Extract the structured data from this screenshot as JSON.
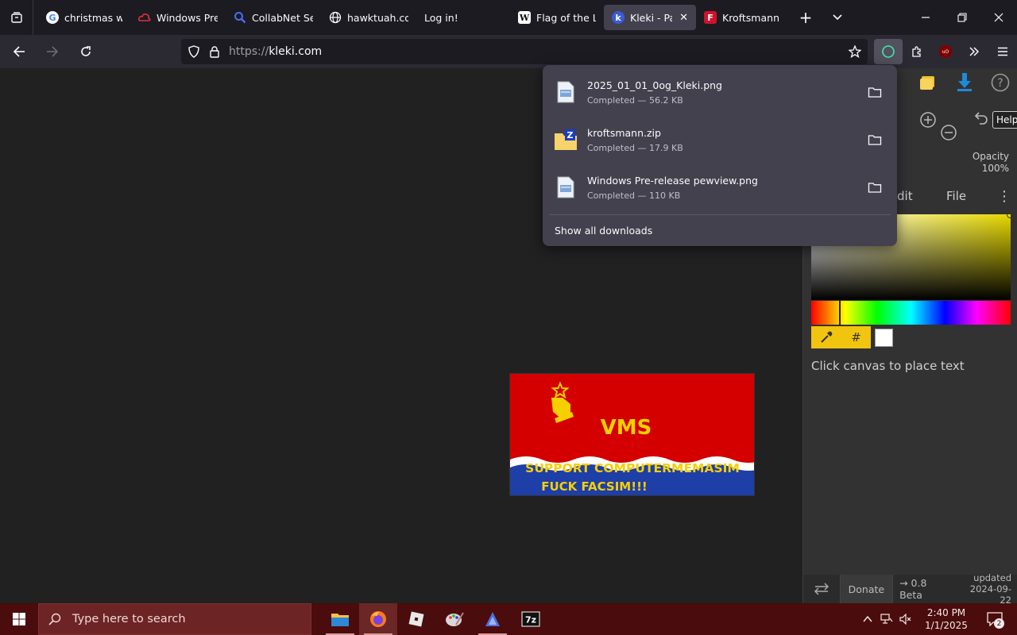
{
  "browser": {
    "tabs": [
      {
        "title": "christmas wall",
        "favicon": "google-icon",
        "active": false
      },
      {
        "title": "Windows Pre-r",
        "favicon": "cloud-icon",
        "active": false
      },
      {
        "title": "CollabNet Sear",
        "favicon": "search-icon",
        "active": false
      },
      {
        "title": "hawktuah.com",
        "favicon": "globe-icon",
        "active": false
      },
      {
        "title": "Log in!",
        "favicon": "",
        "active": false
      },
      {
        "title": "Flag of the Lat",
        "favicon": "wikipedia-icon",
        "active": false
      },
      {
        "title": "Kleki - Paint",
        "favicon": "kleki-icon",
        "active": true
      },
      {
        "title": "Kroftsmann Fo",
        "favicon": "f-icon",
        "active": false
      }
    ],
    "url": {
      "protocol": "https://",
      "host": "kleki.com"
    }
  },
  "downloads": {
    "items": [
      {
        "name": "2025_01_01_0og_Kleki.png",
        "status": "Completed — 56.2 KB",
        "type": "png"
      },
      {
        "name": "kroftsmann.zip",
        "status": "Completed — 17.9 KB",
        "type": "zip"
      },
      {
        "name": "Windows Pre-release pewview.png",
        "status": "Completed — 110 KB",
        "type": "png"
      }
    ],
    "show_all": "Show all downloads"
  },
  "kleki": {
    "tooltip": "Help",
    "opacity_label": "Opacity",
    "opacity_value": "100%",
    "tabs": [
      "dit",
      "File"
    ],
    "hex_label": "#",
    "hint": "Click canvas to place text",
    "footer": {
      "donate": "Donate",
      "version": "→ 0.8 Beta",
      "updated_label": "updated",
      "updated_date": "2024-09-22"
    },
    "flag": {
      "title": "VMS",
      "line1": "SUPPORT COMPUTERMEMASIM",
      "line2": "FUCK FACSIM!!!"
    },
    "colors": {
      "primary": "#e6d800",
      "flag_red": "#d40000",
      "flag_blue": "#1e3ea8",
      "flag_yellow": "#f5d000"
    }
  },
  "taskbar": {
    "search_placeholder": "Type here to search",
    "time": "2:40 PM",
    "date": "1/1/2025",
    "notifications": "2"
  }
}
